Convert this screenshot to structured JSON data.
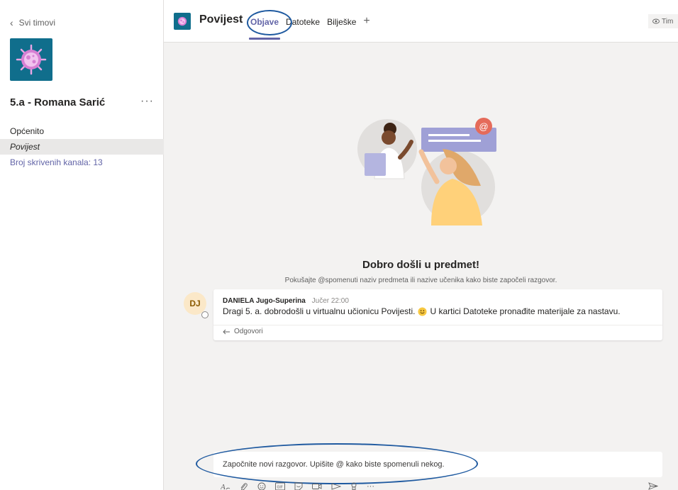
{
  "sidebar": {
    "back_label": "Svi timovi",
    "team_name": "5.a - Romana Sarić",
    "more_label": "···",
    "channels": [
      {
        "label": "Općenito"
      },
      {
        "label": "Povijest"
      },
      {
        "label": "Broj skrivenih kanala: 13"
      }
    ],
    "active_channel": "Povijest"
  },
  "header": {
    "title": "Povijest",
    "tabs": [
      {
        "label": "Objave"
      },
      {
        "label": "Datoteke"
      },
      {
        "label": "Bilješke"
      }
    ],
    "add_tab": "+",
    "right_label": "Tim"
  },
  "welcome": {
    "title": "Dobro došli u predmet!",
    "subtitle": "Pokušajte @spomenuti naziv predmeta ili nazive učenika kako biste započeli razgovor."
  },
  "post": {
    "avatar_initials": "DJ",
    "author": "DANIELA Jugo-Superina",
    "time": "Jučer 22:00",
    "body_part1": "Dragi 5. a. dobrodošli u virtualnu učionicu Povijesti.",
    "body_part2": "U kartici Datoteke pronađite materijale za nastavu.",
    "reply_label": "Odgovori"
  },
  "compose": {
    "placeholder": "Započnite novi razgovor. Upišite @ kako biste spomenuli nekog."
  },
  "toolbar": {
    "more_label": "···"
  },
  "colors": {
    "accent": "#6264a7",
    "annotation": "#1f5aa0",
    "team_tile": "#106e8c",
    "background": "#f3f2f1"
  }
}
